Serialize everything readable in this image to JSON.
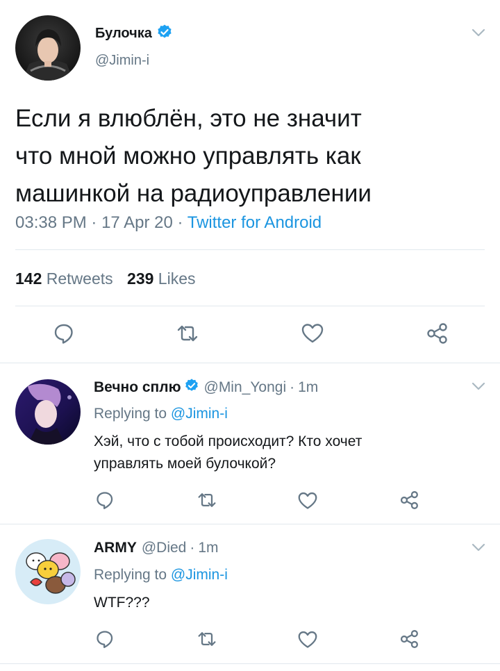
{
  "colors": {
    "text": "#14171a",
    "secondary": "#657786",
    "link": "#1b95e0",
    "divider": "#e1e8ed"
  },
  "main_tweet": {
    "display_name": "Булочка",
    "handle": "@Jimin-i",
    "text_lines": [
      "Если я влюблён, это не значит",
      "что мной можно управлять как",
      "машинкой на радиоуправлении"
    ],
    "time": "03:38 PM",
    "date": "17 Apr 20",
    "source": "Twitter for Android",
    "retweets_count": "142",
    "retweets_label": "Retweets",
    "likes_count": "239",
    "likes_label": "Likes"
  },
  "replies": [
    {
      "display_name": "Вечно сплю",
      "handle": "@Min_Yongi",
      "time": "1m",
      "replying_prefix": "Replying to",
      "replying_to": "@Jimin-i",
      "text_lines": [
        "Хэй, что с тобой происходит? Кто хочет",
        "управлять моей булочкой?"
      ]
    },
    {
      "display_name": "ARMY",
      "handle": "@Died",
      "time": "1m",
      "replying_prefix": "Replying to",
      "replying_to": "@Jimin-i",
      "text_lines": [
        "WTF???"
      ]
    }
  ],
  "separator": "·"
}
